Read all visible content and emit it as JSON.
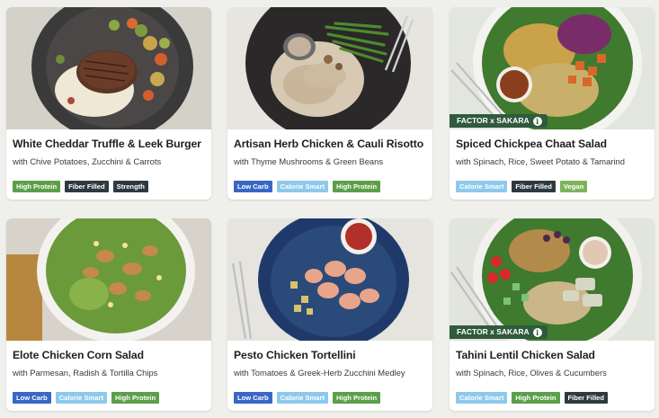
{
  "colors": {
    "high_protein": "#5c9f4a",
    "fiber_filled": "#2f3a40",
    "strength": "#2f3a40",
    "low_carb": "#3a67c6",
    "calorie_smart": "#8dc9ec",
    "vegan": "#7bb55a",
    "partner_badge": "#2f5a3c"
  },
  "meals": [
    {
      "title": "White Cheddar Truffle & Leek Burger",
      "subtitle": "with Chive Potatoes, Zucchini & Carrots",
      "image_icon": "burger-plate-photo",
      "tags": [
        {
          "label": "High Protein",
          "color": "#5c9f4a"
        },
        {
          "label": "Fiber Filled",
          "color": "#2f3a40"
        },
        {
          "label": "Strength",
          "color": "#2f3a40"
        }
      ]
    },
    {
      "title": "Artisan Herb Chicken & Cauli Risotto",
      "subtitle": "with Thyme Mushrooms & Green Beans",
      "image_icon": "chicken-risotto-photo",
      "tags": [
        {
          "label": "Low Carb",
          "color": "#3a67c6"
        },
        {
          "label": "Calorie Smart",
          "color": "#8dc9ec"
        },
        {
          "label": "High Protein",
          "color": "#5c9f4a"
        }
      ]
    },
    {
      "title": "Spiced Chickpea Chaat Salad",
      "subtitle": "with Spinach, Rice, Sweet Potato & Tamarind",
      "image_icon": "chickpea-salad-photo",
      "partner_badge": "FACTOR x SAKARA",
      "tags": [
        {
          "label": "Calorie Smart",
          "color": "#8dc9ec"
        },
        {
          "label": "Fiber Filled",
          "color": "#2f3a40"
        },
        {
          "label": "Vegan",
          "color": "#7bb55a"
        }
      ]
    },
    {
      "title": "Elote Chicken Corn Salad",
      "subtitle": "with Parmesan, Radish & Tortilla Chips",
      "image_icon": "corn-salad-photo",
      "tags": [
        {
          "label": "Low Carb",
          "color": "#3a67c6"
        },
        {
          "label": "Calorie Smart",
          "color": "#8dc9ec"
        },
        {
          "label": "High Protein",
          "color": "#5c9f4a"
        }
      ]
    },
    {
      "title": "Pesto Chicken Tortellini",
      "subtitle": "with Tomatoes & Greek-Herb Zucchini Medley",
      "image_icon": "tortellini-photo",
      "tags": [
        {
          "label": "Low Carb",
          "color": "#3a67c6"
        },
        {
          "label": "Calorie Smart",
          "color": "#8dc9ec"
        },
        {
          "label": "High Protein",
          "color": "#5c9f4a"
        }
      ]
    },
    {
      "title": "Tahini Lentil Chicken Salad",
      "subtitle": "with Spinach, Rice, Olives & Cucumbers",
      "image_icon": "lentil-salad-photo",
      "partner_badge": "FACTOR x SAKARA",
      "tags": [
        {
          "label": "Calorie Smart",
          "color": "#8dc9ec"
        },
        {
          "label": "High Protein",
          "color": "#5c9f4a"
        },
        {
          "label": "Fiber Filled",
          "color": "#2f3a40"
        }
      ]
    }
  ]
}
